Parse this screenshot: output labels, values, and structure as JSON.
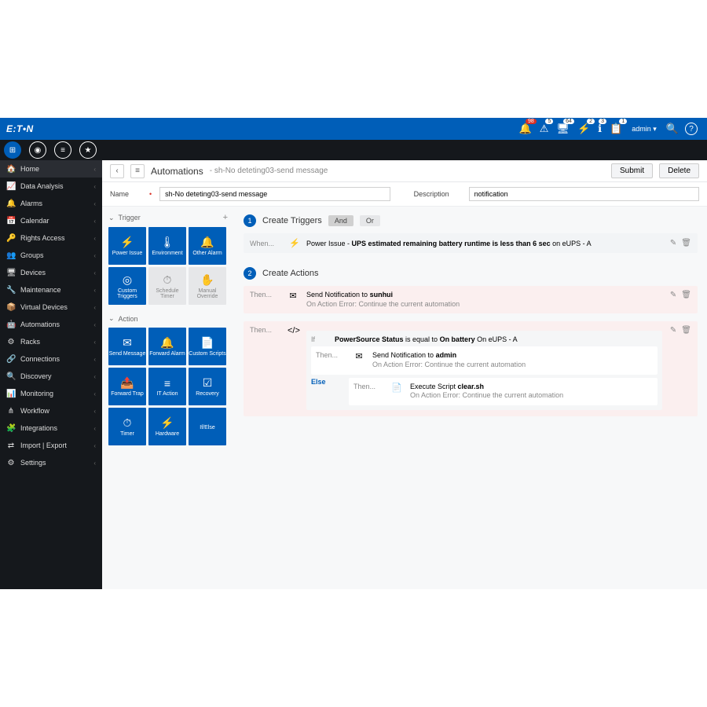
{
  "brand": "E:T•N",
  "topbar": {
    "notifications": [
      {
        "icon": "🔔",
        "badge": "98",
        "color": "red"
      },
      {
        "icon": "⚠",
        "badge": "5"
      },
      {
        "icon": "🖥",
        "badge": "64"
      },
      {
        "icon": "⚡",
        "badge": "2"
      },
      {
        "icon": "ℹ",
        "badge": "3"
      },
      {
        "icon": "📋",
        "badge": "1"
      }
    ],
    "user": "admin",
    "search_icon": "🔍",
    "help_icon": "?"
  },
  "sidebar": [
    {
      "icon": "🏠",
      "label": "Home",
      "active": true
    },
    {
      "icon": "📈",
      "label": "Data Analysis"
    },
    {
      "icon": "🔔",
      "label": "Alarms"
    },
    {
      "icon": "📅",
      "label": "Calendar"
    },
    {
      "icon": "🔑",
      "label": "Rights Access"
    },
    {
      "icon": "👥",
      "label": "Groups"
    },
    {
      "icon": "🖥",
      "label": "Devices"
    },
    {
      "icon": "🔧",
      "label": "Maintenance"
    },
    {
      "icon": "📦",
      "label": "Virtual Devices"
    },
    {
      "icon": "🤖",
      "label": "Automations"
    },
    {
      "icon": "⚙",
      "label": "Racks"
    },
    {
      "icon": "🔗",
      "label": "Connections"
    },
    {
      "icon": "🔍",
      "label": "Discovery"
    },
    {
      "icon": "📊",
      "label": "Monitoring"
    },
    {
      "icon": "⋔",
      "label": "Workflow"
    },
    {
      "icon": "🧩",
      "label": "Integrations"
    },
    {
      "icon": "⇄",
      "label": "Import | Export"
    },
    {
      "icon": "⚙",
      "label": "Settings"
    }
  ],
  "page": {
    "title": "Automations",
    "subtitle": "sh-No deteting03-send message",
    "submit": "Submit",
    "delete": "Delete"
  },
  "form": {
    "name_label": "Name",
    "name_value": "sh-No deteting03-send message",
    "desc_label": "Description",
    "desc_value": "notification"
  },
  "palette": {
    "trigger_label": "Trigger",
    "action_label": "Action",
    "triggers": [
      {
        "icon": "⚡",
        "label": "Power Issue"
      },
      {
        "icon": "🌡",
        "label": "Environment"
      },
      {
        "icon": "🔔",
        "label": "Other Alarm"
      },
      {
        "icon": "◎",
        "label": "Custom Triggers"
      },
      {
        "icon": "⏱",
        "label": "Schedule Timer",
        "disabled": true
      },
      {
        "icon": "✋",
        "label": "Manual Override",
        "disabled": true
      }
    ],
    "actions": [
      {
        "icon": "✉",
        "label": "Send Message"
      },
      {
        "icon": "🔔",
        "label": "Forward Alarm"
      },
      {
        "icon": "📄",
        "label": "Custom Scripts"
      },
      {
        "icon": "📤",
        "label": "Forward Trap"
      },
      {
        "icon": "≡",
        "label": "IT Action"
      },
      {
        "icon": "☑",
        "label": "Recovery"
      },
      {
        "icon": "⏱",
        "label": "Timer"
      },
      {
        "icon": "⚡",
        "label": "Hardware"
      },
      {
        "icon": "</>",
        "label": "If/Else"
      }
    ]
  },
  "canvas": {
    "step1": {
      "num": "1",
      "label": "Create Triggers",
      "and": "And",
      "or": "Or"
    },
    "trigger_when": "When...",
    "trigger_text_prefix": "Power Issue - ",
    "trigger_text_bold": "UPS estimated remaining battery runtime is less than 6 sec",
    "trigger_text_suffix": " on eUPS - A",
    "step2": {
      "num": "2",
      "label": "Create Actions"
    },
    "then_label": "Then...",
    "action1_line1": "Send Notification to ",
    "action1_bold": "sunhui",
    "action1_line2": "On Action Error: Continue the current automation",
    "if_label": "If",
    "if_text1": "PowerSource Status",
    "if_text2": " is equal to ",
    "if_text3": "On battery",
    "if_text4": " On eUPS - A",
    "nested_then1_line1": "Send Notification to ",
    "nested_then1_bold": "admin",
    "nested_then1_line2": "On Action Error: Continue the current automation",
    "else_label": "Else",
    "nested_else_line1": "Execute Script ",
    "nested_else_bold": "clear.sh",
    "nested_else_line2": "On Action Error: Continue the current automation"
  }
}
